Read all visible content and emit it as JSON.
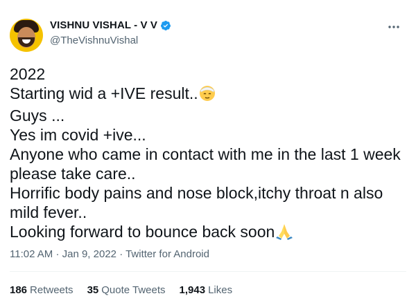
{
  "author": {
    "name": "VISHNU VISHAL - V V",
    "handle": "@TheVishnuVishal"
  },
  "tweet": {
    "lines": [
      "2022",
      "Starting wid a +IVE result..",
      "Guys ...",
      "Yes im covid +ive...",
      "Anyone who came in contact with me in the last 1 week",
      "please take care..",
      "Horrific body pains and nose block,itchy throat n also",
      "mild fever..",
      "Looking forward to bounce back soon"
    ],
    "emojis": [
      "face-with-head-bandage",
      "folded-hands"
    ]
  },
  "meta": {
    "time": "11:02 AM",
    "separator1": "·",
    "date": "Jan 9, 2022",
    "separator2": "·",
    "source": "Twitter for Android"
  },
  "stats": {
    "retweets_count": "186",
    "retweets_label": "Retweets",
    "quotes_count": "35",
    "quotes_label": "Quote Tweets",
    "likes_count": "1,943",
    "likes_label": "Likes"
  },
  "colors": {
    "text": "#0f1419",
    "secondary": "#536471",
    "verified": "#1d9bf0",
    "divider": "#eff3f4"
  }
}
